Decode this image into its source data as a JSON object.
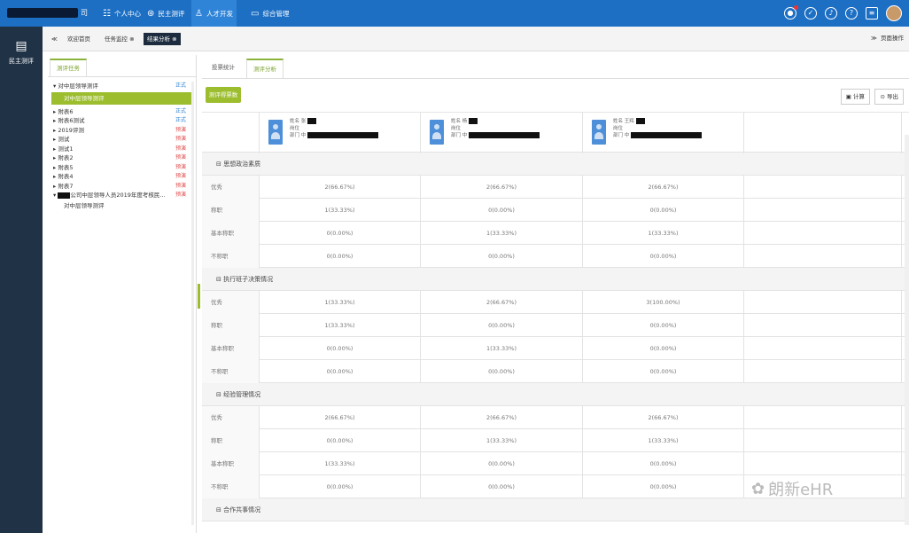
{
  "topbar": {
    "brand_suffix": "司",
    "nav": [
      {
        "label": "个人中心",
        "icon": "user-center-icon",
        "glyph": "☷"
      },
      {
        "label": "民主测评",
        "icon": "evaluation-icon",
        "glyph": "⊛"
      },
      {
        "label": "人才开发",
        "icon": "talent-icon",
        "glyph": "♙"
      },
      {
        "label": "综合管理",
        "icon": "monitor-icon",
        "glyph": "▭"
      }
    ]
  },
  "sidebar": {
    "label": "民主测评"
  },
  "tabsbar": {
    "back": "≪",
    "home": "欢迎首页",
    "tab1": "任务监控",
    "tab2": "结果分析",
    "forward": "≫",
    "page_ops": "页面操作"
  },
  "left": {
    "tab": "测评任务",
    "tree": [
      {
        "label": "▾ 对中层领导测评",
        "status": "正式",
        "kind": "ok"
      },
      {
        "label": "对中层领导测评",
        "status": "",
        "kind": "hl"
      },
      {
        "label": "▸ 附表6",
        "status": "正式",
        "kind": "ok"
      },
      {
        "label": "▸ 附表6测试",
        "status": "正式",
        "kind": "ok"
      },
      {
        "label": "▸ 2019评测",
        "status": "预演",
        "kind": "pre"
      },
      {
        "label": "▸ 测试",
        "status": "预演",
        "kind": "pre"
      },
      {
        "label": "▸ 测试1",
        "status": "预演",
        "kind": "pre"
      },
      {
        "label": "▸ 附表2",
        "status": "预演",
        "kind": "pre"
      },
      {
        "label": "▸ 附表5",
        "status": "预演",
        "kind": "pre"
      },
      {
        "label": "▸ 附表4",
        "status": "预演",
        "kind": "pre"
      },
      {
        "label": "▸ 附表7",
        "status": "预演",
        "kind": "pre"
      },
      {
        "label": "公司中层领导人员2019年度考核民...",
        "status": "预演",
        "kind": "pre"
      },
      {
        "label": "对中层领导测评",
        "status": "",
        "kind": "child"
      }
    ]
  },
  "main": {
    "tab1": "投票统计",
    "tab2": "测评分析",
    "green_btn": "测评得票数",
    "calc": "计算",
    "export": "导出",
    "persons": [
      {
        "name": "姓名 张",
        "pos": "岗位",
        "dept": "部门 中"
      },
      {
        "name": "姓名 杨",
        "pos": "岗位",
        "dept": "部门 中"
      },
      {
        "name": "姓名 王辉",
        "pos": "岗位",
        "dept": "部门 中"
      }
    ],
    "sections": [
      {
        "title": "思想政治素质",
        "rows": [
          [
            "优秀",
            "2(66.67%)",
            "2(66.67%)",
            "2(66.67%)"
          ],
          [
            "称职",
            "1(33.33%)",
            "0(0.00%)",
            "0(0.00%)"
          ],
          [
            "基本称职",
            "0(0.00%)",
            "1(33.33%)",
            "1(33.33%)"
          ],
          [
            "不称职",
            "0(0.00%)",
            "0(0.00%)",
            "0(0.00%)"
          ]
        ]
      },
      {
        "title": "执行班子决策情况",
        "rows": [
          [
            "优秀",
            "1(33.33%)",
            "2(66.67%)",
            "3(100.00%)"
          ],
          [
            "称职",
            "1(33.33%)",
            "0(0.00%)",
            "0(0.00%)"
          ],
          [
            "基本称职",
            "0(0.00%)",
            "1(33.33%)",
            "0(0.00%)"
          ],
          [
            "不称职",
            "0(0.00%)",
            "0(0.00%)",
            "0(0.00%)"
          ]
        ]
      },
      {
        "title": "经验管理情况",
        "rows": [
          [
            "优秀",
            "2(66.67%)",
            "2(66.67%)",
            "2(66.67%)"
          ],
          [
            "称职",
            "0(0.00%)",
            "1(33.33%)",
            "1(33.33%)"
          ],
          [
            "基本称职",
            "1(33.33%)",
            "0(0.00%)",
            "0(0.00%)"
          ],
          [
            "不称职",
            "0(0.00%)",
            "0(0.00%)",
            "0(0.00%)"
          ]
        ]
      },
      {
        "title": "合作共事情况",
        "rows": []
      }
    ]
  },
  "watermark": "朗新eHR"
}
